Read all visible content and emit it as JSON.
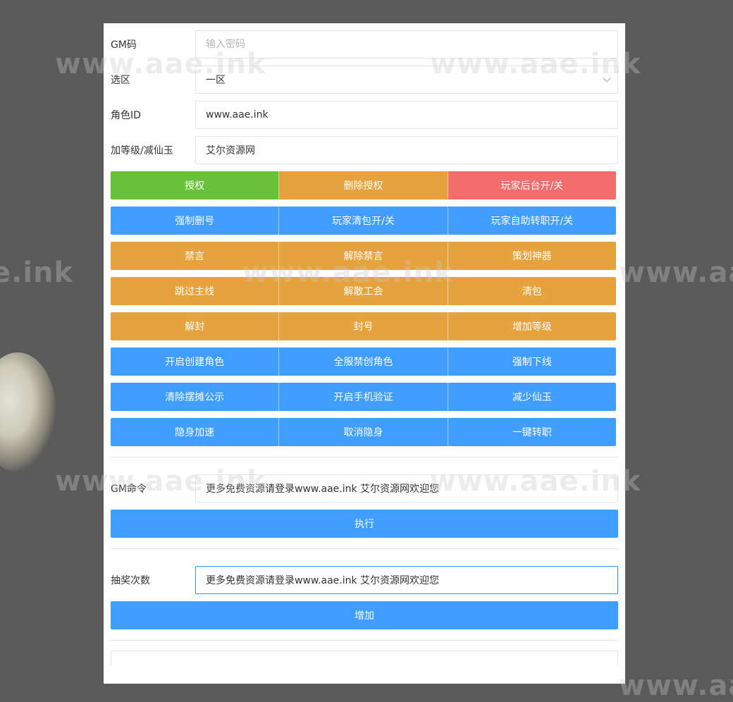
{
  "form": {
    "gm_code": {
      "label": "GM码",
      "placeholder": "输入密码",
      "value": ""
    },
    "zone": {
      "label": "选区",
      "selected": "一区"
    },
    "role_id": {
      "label": "角色ID",
      "value": "www.aae.ink"
    },
    "level": {
      "label": "加等级/减仙玉",
      "value": "艾尔资源网"
    }
  },
  "button_rows": [
    [
      {
        "label": "授权",
        "color": "green"
      },
      {
        "label": "删除授权",
        "color": "orange"
      },
      {
        "label": "玩家后台开/关",
        "color": "red"
      }
    ],
    [
      {
        "label": "强制删号",
        "color": "blue"
      },
      {
        "label": "玩家清包开/关",
        "color": "blue"
      },
      {
        "label": "玩家自助转职开/关",
        "color": "blue"
      }
    ],
    [
      {
        "label": "禁言",
        "color": "orange"
      },
      {
        "label": "解除禁言",
        "color": "orange"
      },
      {
        "label": "策划神器",
        "color": "orange"
      }
    ],
    [
      {
        "label": "跳过主线",
        "color": "orange"
      },
      {
        "label": "解散工会",
        "color": "orange"
      },
      {
        "label": "清包",
        "color": "orange"
      }
    ],
    [
      {
        "label": "解封",
        "color": "orange"
      },
      {
        "label": "封号",
        "color": "orange"
      },
      {
        "label": "增加等级",
        "color": "orange"
      }
    ],
    [
      {
        "label": "开启创建角色",
        "color": "blue"
      },
      {
        "label": "全服禁创角色",
        "color": "blue"
      },
      {
        "label": "强制下线",
        "color": "blue"
      }
    ],
    [
      {
        "label": "清除摆摊公示",
        "color": "blue"
      },
      {
        "label": "开启手机验证",
        "color": "blue"
      },
      {
        "label": "减少仙玉",
        "color": "blue"
      }
    ],
    [
      {
        "label": "隐身加速",
        "color": "blue"
      },
      {
        "label": "取消隐身",
        "color": "blue"
      },
      {
        "label": "一键转职",
        "color": "blue"
      }
    ]
  ],
  "gm_command": {
    "label": "GM命令",
    "value": "更多免费资源请登录www.aae.ink 艾尔资源网欢迎您",
    "button": "执行"
  },
  "lottery": {
    "label": "抽奖次数",
    "value": "更多免费资源请登录www.aae.ink 艾尔资源网欢迎您",
    "button": "增加"
  },
  "watermarks": [
    "www.aae.ink",
    "www.aae.ink",
    "e.ink",
    "www.aae.ink",
    "www.aae.ink",
    "www.aae.ink",
    "www.aae.ink",
    "www.aae.ink"
  ],
  "colors": {
    "blue": "#409eff",
    "green": "#67c23a",
    "orange": "#e6a23c",
    "red": "#f56c6c",
    "overlay": "#5a5a5a"
  }
}
